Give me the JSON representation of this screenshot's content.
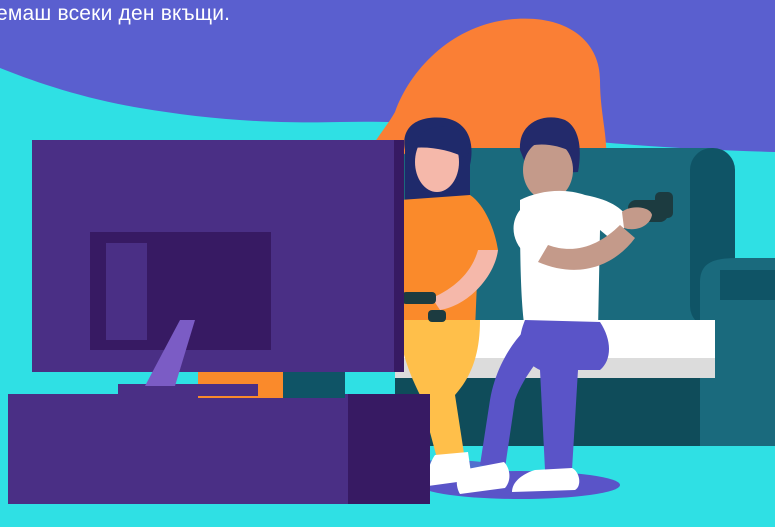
{
  "banner": {
    "tagline": "емаш всеки ден вкъщи."
  },
  "colors": {
    "sky_purple": "#5a5fcf",
    "floor_cyan": "#2fe0e4",
    "blob_orange": "#fa7f35",
    "sofa_teal": "#1a6a7d",
    "sofa_dark": "#0f5466",
    "tv_purple": "#4a2f85",
    "tv_dark": "#371a63",
    "shirt_orange": "#fa8a2b",
    "pants_yellow": "#ffbf4a",
    "pants_purple": "#5a54c8",
    "skin": "#f5b8aa",
    "skin_tan": "#c49a8a",
    "hair_navy": "#232a6b",
    "controller": "#1c3b40"
  },
  "illustration": {
    "subject": "two people playing video games on a sofa in front of a TV"
  }
}
